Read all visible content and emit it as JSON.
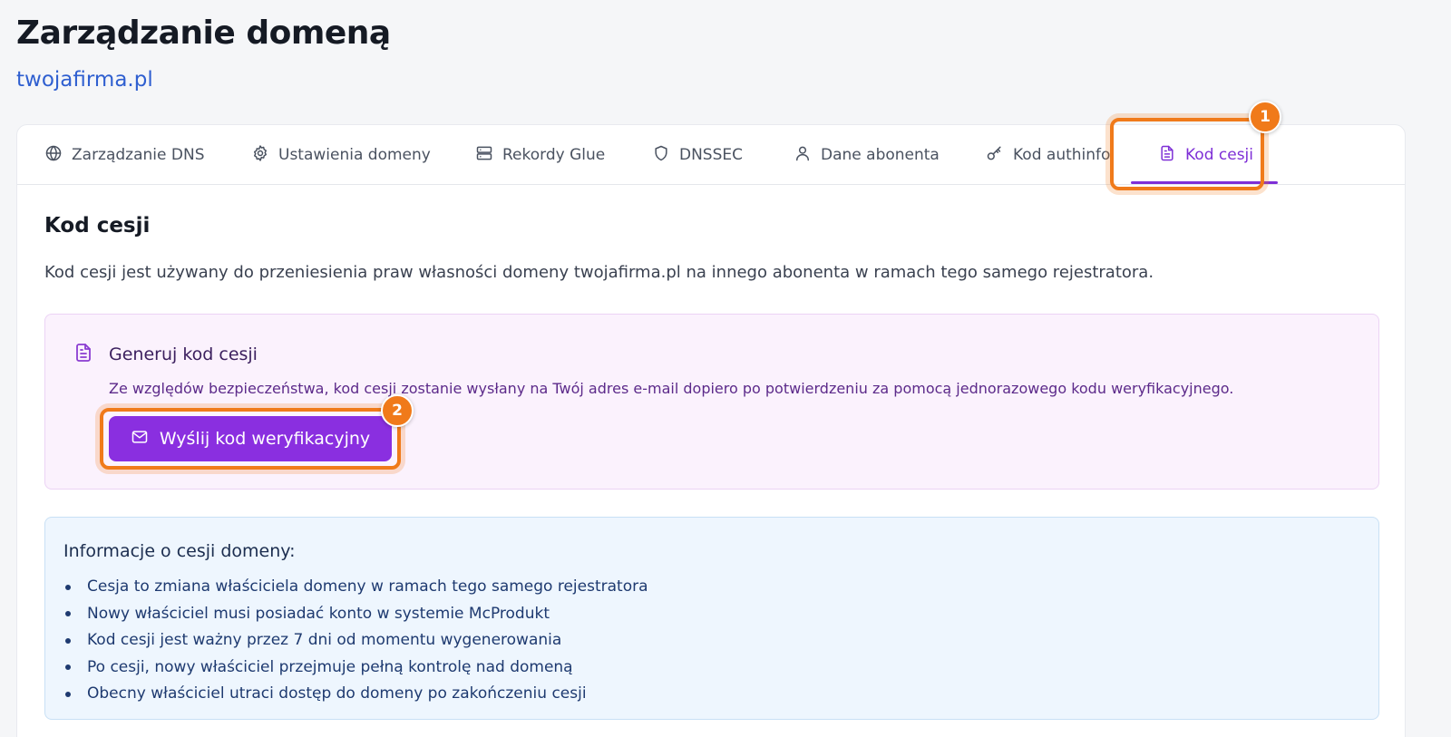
{
  "page": {
    "title": "Zarządzanie domeną",
    "domain": "twojafirma.pl"
  },
  "tabs": [
    {
      "label": "Zarządzanie DNS",
      "icon": "globe-icon"
    },
    {
      "label": "Ustawienia domeny",
      "icon": "gear-icon"
    },
    {
      "label": "Rekordy Glue",
      "icon": "server-icon"
    },
    {
      "label": "DNSSEC",
      "icon": "shield-icon"
    },
    {
      "label": "Dane abonenta",
      "icon": "user-icon"
    },
    {
      "label": "Kod authinfo",
      "icon": "key-icon"
    },
    {
      "label": "Kod cesji",
      "icon": "document-icon",
      "active": true
    }
  ],
  "badges": {
    "tab": "1",
    "button": "2"
  },
  "section": {
    "title": "Kod cesji",
    "description": "Kod cesji jest używany do przeniesienia praw własności domeny twojafirma.pl na innego abonenta w ramach tego samego rejestratora."
  },
  "generate": {
    "title": "Generuj kod cesji",
    "text": "Ze względów bezpieczeństwa, kod cesji zostanie wysłany na Twój adres e-mail dopiero po potwierdzeniu za pomocą jednorazowego kodu weryfikacyjnego.",
    "button_label": "Wyślij kod weryfikacyjny"
  },
  "info": {
    "title": "Informacje o cesji domeny:",
    "items": [
      "Cesja to zmiana właściciela domeny w ramach tego samego rejestratora",
      "Nowy właściciel musi posiadać konto w systemie McProdukt",
      "Kod cesji jest ważny przez 7 dni od momentu wygenerowania",
      "Po cesji, nowy właściciel przejmuje pełną kontrolę nad domeną",
      "Obecny właściciel utraci dostęp do domeny po zakończeniu cesji"
    ]
  },
  "colors": {
    "accent": "#8a2fe0",
    "highlight": "#f07a1a",
    "link": "#2f5fd0"
  }
}
